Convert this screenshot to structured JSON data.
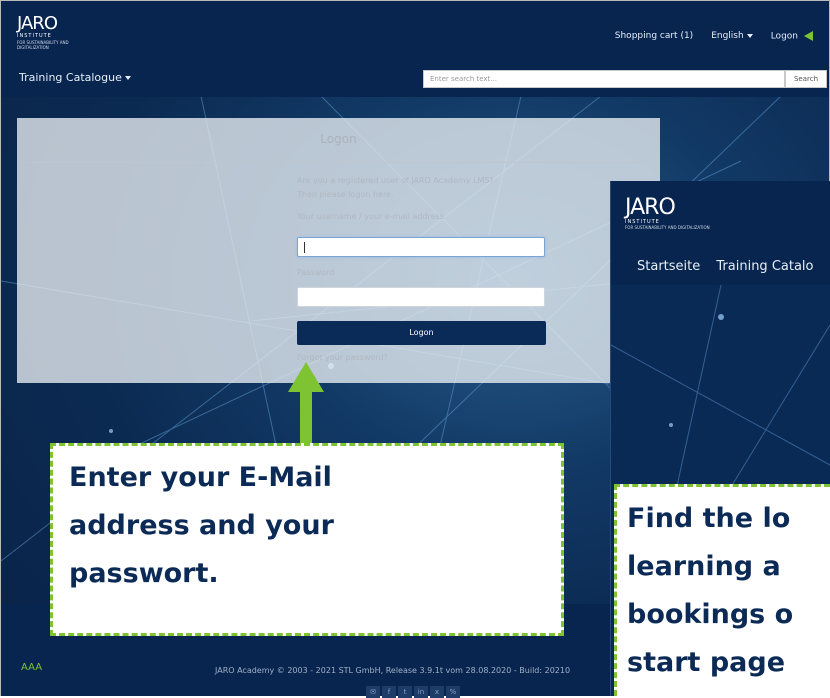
{
  "header": {
    "logo_mark": "JARO",
    "logo_institute": "INSTITUTE",
    "logo_tagline": "FOR SUSTAINABILITY AND DIGITALIZATION",
    "shopping_cart": "Shopping cart (1)",
    "language": "English",
    "logon": "Logon"
  },
  "nav": {
    "catalogue": "Training Catalogue"
  },
  "search": {
    "placeholder": "Enter search text...",
    "button": "Search"
  },
  "panel": {
    "title": "Logon",
    "intro_line1": "Are you a registered user of JARO Academy LMS?",
    "intro_line2": "Then please logon here.",
    "username_label": "Your username / your e-mail address",
    "password_label": "Password",
    "logon_button": "Logon",
    "forgot_link": "Forgot your password?"
  },
  "footer": {
    "font_size_control": "AAA",
    "copyright": "JARO Academy © 2003 - 2021 STL GmbH, Release 3.9.1t vom 28.08.2020 - Build: 20210"
  },
  "inset": {
    "logo_mark": "JARO",
    "logo_institute": "INSTITUTE",
    "logo_tagline": "FOR SUSTAINABILITY AND DIGITALIZATION",
    "nav_home": "Startseite",
    "nav_catalogue": "Training Catalo"
  },
  "callouts": {
    "main": [
      "Enter your E-Mail",
      "address and your",
      "passwort."
    ],
    "side": [
      "Find the lo",
      "learning a",
      "bookings o",
      "start page"
    ]
  },
  "colors": {
    "navy": "#082550",
    "accent_green": "#7ec332"
  },
  "icons": [
    "mail-icon",
    "facebook-icon",
    "twitter-icon",
    "linkedin-icon",
    "xing-icon",
    "link-icon"
  ]
}
